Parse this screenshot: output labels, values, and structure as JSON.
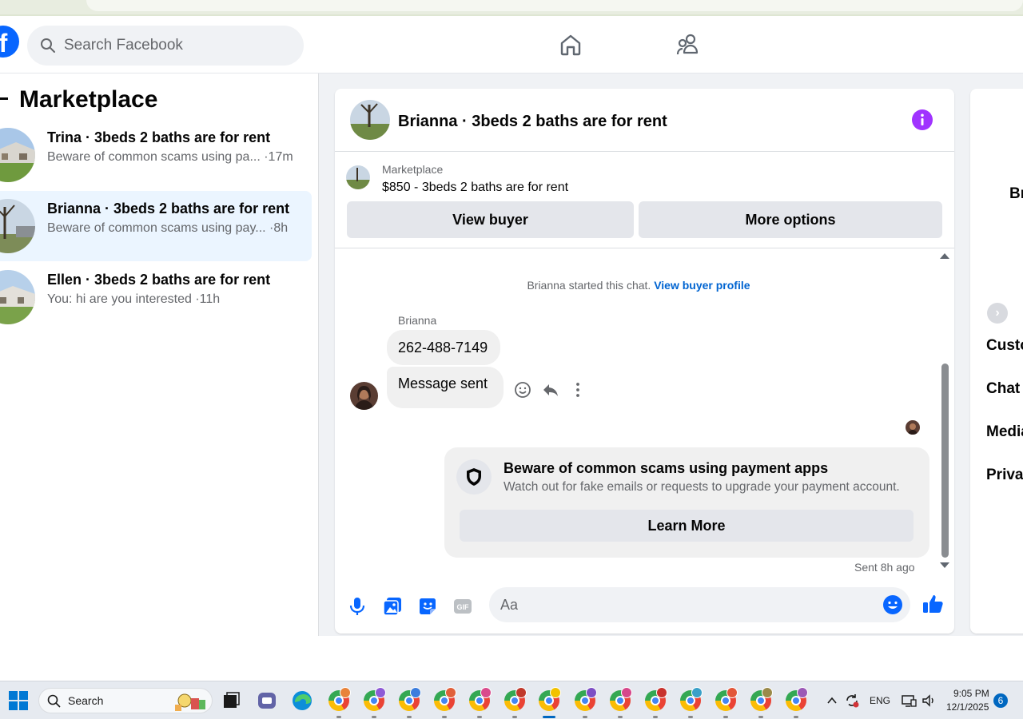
{
  "topbar": {
    "logo": "f",
    "search_placeholder": "Search Facebook",
    "nav": [
      "home-icon",
      "friends-icon"
    ]
  },
  "sidebar": {
    "title": "Marketplace",
    "chats": [
      {
        "name": "Trina · 3beds 2 baths are for rent",
        "preview": "Beware of common scams using pa... ·17m",
        "active": false
      },
      {
        "name": "Brianna · 3beds 2 baths are for rent",
        "preview": "Beware of common scams using pay... ·8h",
        "active": true
      },
      {
        "name": "Ellen · 3beds 2 baths are for rent",
        "preview": "You: hi are you interested ·11h",
        "active": false
      }
    ]
  },
  "chat": {
    "title": "Brianna · 3beds 2 baths are for rent",
    "listing": {
      "source": "Marketplace",
      "title": "$850 - 3beds 2 baths are for rent",
      "view_buyer_label": "View buyer",
      "more_options_label": "More options"
    },
    "started_text": "Brianna started this chat.",
    "view_buyer_profile": "View buyer profile",
    "sender": "Brianna",
    "messages": [
      "262-488-7149",
      "Message sent"
    ],
    "scam_card": {
      "title": "Beware of common scams using payment apps",
      "subtitle": "Watch out for fake emails or requests to upgrade your payment account.",
      "button": "Learn More"
    },
    "sent_time": "Sent 8h ago",
    "composer_placeholder": "Aa"
  },
  "right_panel": {
    "name_partial": "Br",
    "items": [
      "Custo",
      "Chat r",
      "Media",
      "Privac"
    ]
  },
  "taskbar": {
    "search_placeholder": "Search",
    "language": "ENG",
    "time": "9:05 PM",
    "date": "12/1/2025",
    "notifications": "6"
  },
  "colors": {
    "facebook_blue": "#0866ff",
    "messenger_purple": "#a033ff",
    "link_blue": "#0064d1",
    "active_chat_bg": "#ebf5ff"
  }
}
